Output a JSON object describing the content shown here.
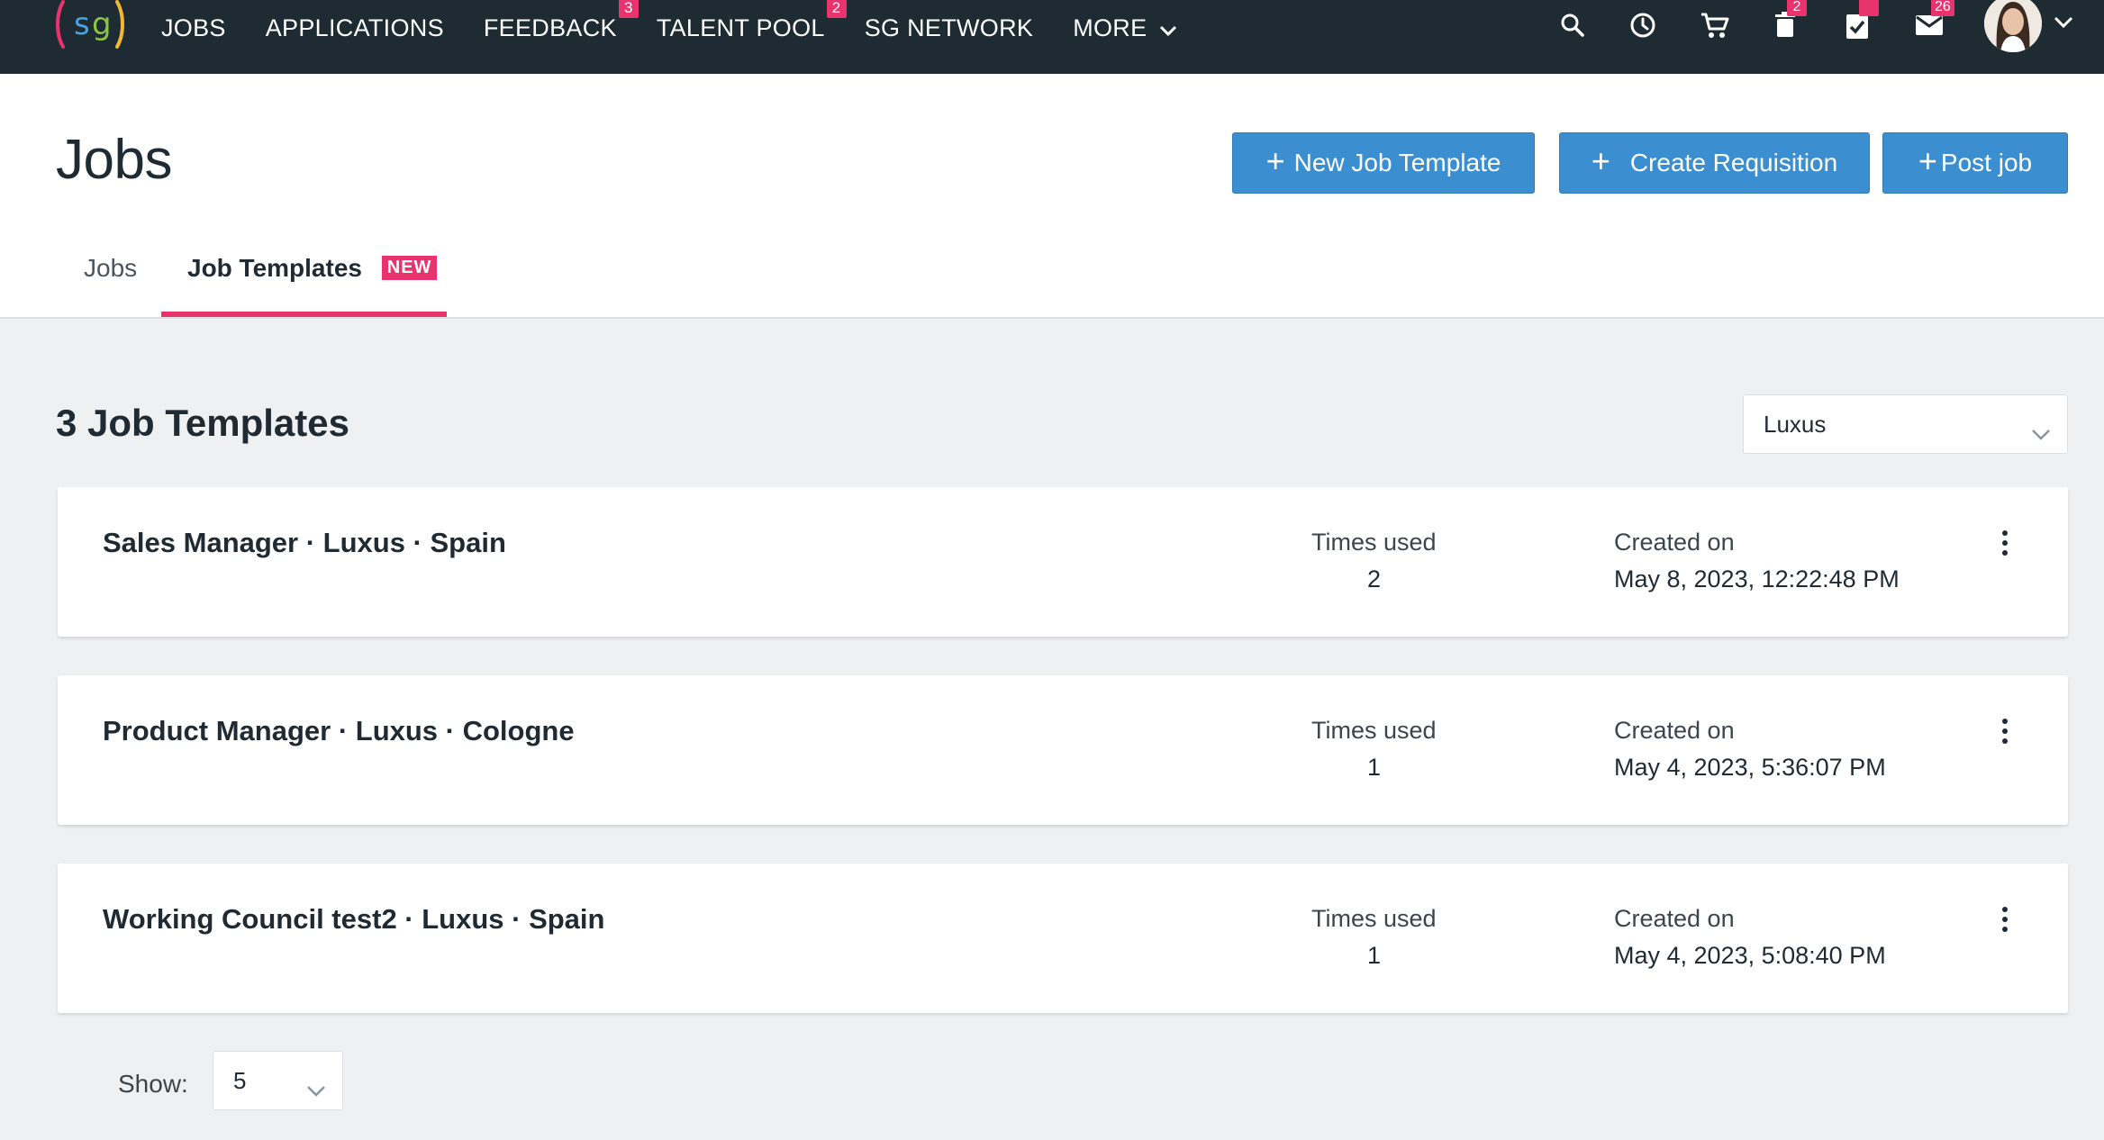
{
  "navbar": {
    "links": [
      {
        "label": "JOBS",
        "badge": ""
      },
      {
        "label": "APPLICATIONS",
        "badge": ""
      },
      {
        "label": "FEEDBACK",
        "badge": "3"
      },
      {
        "label": "TALENT POOL",
        "badge": "2"
      },
      {
        "label": "SG NETWORK",
        "badge": ""
      },
      {
        "label": "MORE",
        "badge": ""
      }
    ],
    "icons": {
      "search": "search-icon",
      "history": "clock-icon",
      "cart": "cart-icon",
      "trash": {
        "icon": "trash-icon",
        "badge": "2"
      },
      "tasks": {
        "icon": "clipboard-check-icon",
        "badge": ""
      },
      "mail": {
        "icon": "mail-icon",
        "badge": "26"
      }
    }
  },
  "header": {
    "title": "Jobs",
    "buttons": {
      "new_template": "New Job Template",
      "create_requisition": "Create Requisition",
      "post_job": "Post job"
    },
    "tabs": [
      {
        "label": "Jobs",
        "active": false
      },
      {
        "label": "Job Templates",
        "active": true,
        "badge": "NEW"
      }
    ]
  },
  "main": {
    "count_title": "3 Job Templates",
    "company_filter": "Luxus",
    "stat_labels": {
      "times_used": "Times used",
      "created_on": "Created on"
    },
    "templates": [
      {
        "title": "Sales Manager · Luxus · Spain",
        "times_used": "2",
        "created_on": "May 8, 2023, 12:22:48 PM"
      },
      {
        "title": "Product Manager · Luxus · Cologne",
        "times_used": "1",
        "created_on": "May 4, 2023, 5:36:07 PM"
      },
      {
        "title": "Working Council test2 · Luxus · Spain",
        "times_used": "1",
        "created_on": "May 4, 2023, 5:08:40 PM"
      }
    ],
    "pagination": {
      "show_label": "Show:",
      "page_size": "5"
    }
  },
  "colors": {
    "navbar_bg": "#1e2b33",
    "primary_button": "#3b8fd0",
    "accent": "#e8336d",
    "page_bg": "#eff0f1"
  }
}
